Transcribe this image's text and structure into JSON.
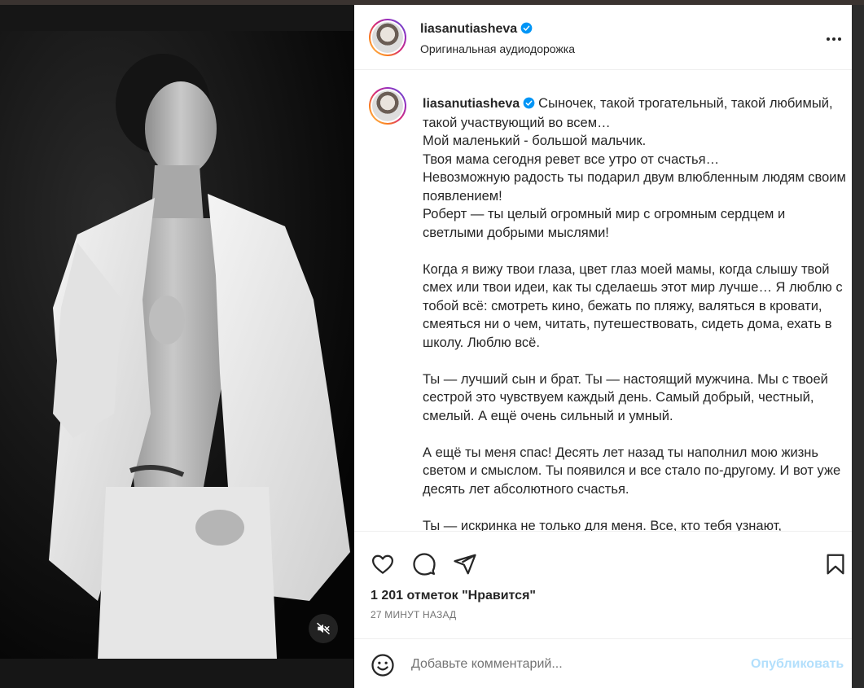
{
  "post": {
    "username": "liasanutiasheva",
    "audio_label": "Оригинальная аудиодорожка",
    "caption": "Сыночек, такой трогательный, такой любимый, такой участвующий во всем…\nМой маленький - большой мальчик.\nТвоя мама сегодня ревет все утро от счастья…\nНевозможную радость ты подарил двум влюбленным людям своим появлением!\nРоберт — ты целый огромный мир с огромным сердцем и светлыми добрыми мыслями!\n\nКогда я вижу твои глаза, цвет глаз моей мамы, когда слышу твой смех или твои идеи, как ты сделаешь этот мир лучше… Я люблю с тобой всё: смотреть кино, бежать по пляжу, валяться в кровати, смеяться ни о чем, читать, путешествовать, сидеть дома, ехать в школу. Люблю всё.\n\nТы — лучший сын и брат. Ты — настоящий мужчина. Мы с твоей сестрой это чувствуем каждый день. Самый добрый, честный, смелый. А ещё очень сильный и умный.\n\nА ещё ты меня спас! Десять лет назад ты наполнил мою жизнь светом и смыслом. Ты появился и все стало по-другому. И вот уже десять лет абсолютного счастья.\n\nТы — искринка не только для меня. Все, кто тебя узнают,",
    "likes": "1 201 отметок \"Нравится\"",
    "time_ago": "27 МИНУТ НАЗАД"
  },
  "comment": {
    "placeholder": "Добавьте комментарий...",
    "publish_label": "Опубликовать"
  },
  "icons": {
    "verified": "verified-badge-icon",
    "more": "more-horizontal-icon",
    "like": "heart-icon",
    "comment": "comment-icon",
    "share": "send-icon",
    "save": "bookmark-icon",
    "emoji": "emoji-icon",
    "mute": "speaker-muted-icon"
  },
  "colors": {
    "verified": "#0095f6",
    "publish_disabled": "#b2dffc",
    "text": "#262626",
    "muted_text": "#737373"
  }
}
